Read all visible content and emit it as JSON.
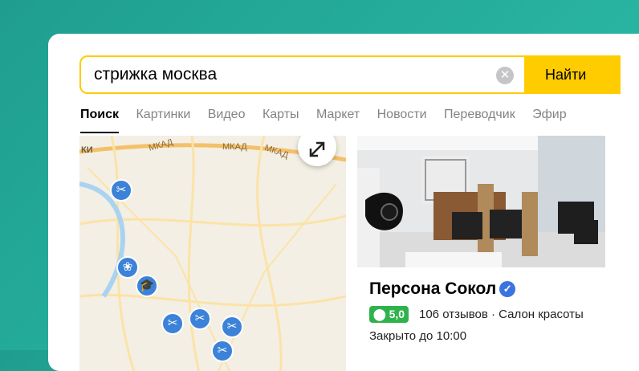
{
  "search": {
    "query": "стрижка москва",
    "clear_icon": "✕",
    "button_label": "Найти"
  },
  "tabs": [
    {
      "label": "Поиск",
      "active": true
    },
    {
      "label": "Картинки"
    },
    {
      "label": "Видео"
    },
    {
      "label": "Карты"
    },
    {
      "label": "Маркет"
    },
    {
      "label": "Новости"
    },
    {
      "label": "Переводчик"
    },
    {
      "label": "Эфир"
    }
  ],
  "map": {
    "labels": [
      "МКАД",
      "МКАД",
      "МКАД",
      "КИ"
    ],
    "expand_icon": "expand-icon",
    "pins": [
      "scissors-icon",
      "lotus-icon",
      "graduation-cap-icon",
      "scissors-icon",
      "scissors-icon",
      "scissors-icon"
    ]
  },
  "business": {
    "name": "Персона Сокол",
    "verified_icon": "✓",
    "rating": "5,0",
    "reviews_text": "106 отзывов · Салон красоты",
    "hours": "Закрыто до 10:00"
  },
  "colors": {
    "accent": "#ffcc00",
    "background": "#27b09e",
    "pin": "#3b82d8",
    "rating": "#2fb24c",
    "verified": "#3b74e0"
  }
}
